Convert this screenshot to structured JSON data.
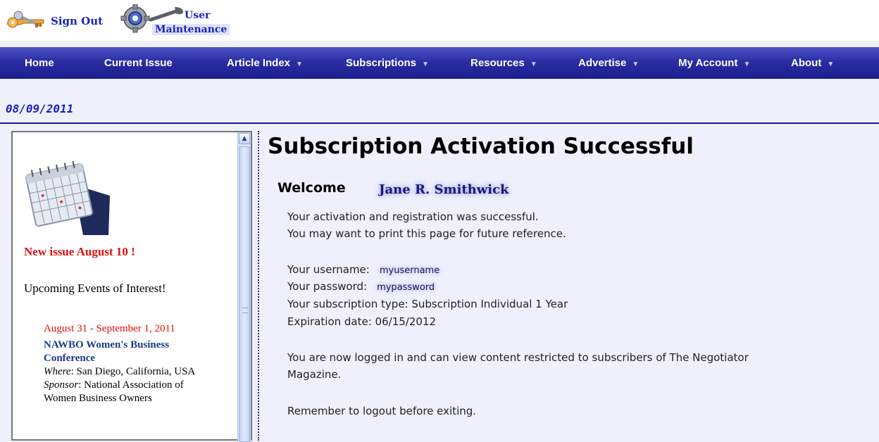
{
  "header": {
    "signout_label": "Sign Out",
    "user_maint_line1": "User",
    "user_maint_line2": "Maintenance"
  },
  "nav": {
    "items": [
      {
        "label": "Home",
        "has_dropdown": false
      },
      {
        "label": "Current Issue",
        "has_dropdown": false
      },
      {
        "label": "Article Index",
        "has_dropdown": true
      },
      {
        "label": "Subscriptions",
        "has_dropdown": true
      },
      {
        "label": "Resources",
        "has_dropdown": true
      },
      {
        "label": "Advertise",
        "has_dropdown": true
      },
      {
        "label": "My Account",
        "has_dropdown": true
      },
      {
        "label": "About",
        "has_dropdown": true
      }
    ],
    "dropdown_glyph": "▼"
  },
  "date": "08/09/2011",
  "sidebar": {
    "new_issue": "New issue August 10 !",
    "upcoming": "Upcoming Events of Interest!",
    "event": {
      "date": "August 31 - September 1,  2011",
      "title": "NAWBO Women's Business Conference",
      "where_key": "Where",
      "where_value": ": San Diego, California, USA",
      "sponsor_key": "Sponsor",
      "sponsor_value": ": National Association of Women Business Owners"
    }
  },
  "main": {
    "title": "Subscription Activation Successful",
    "welcome_label": "Welcome",
    "welcome_name": "Jane R. Smithwick",
    "line1": "Your activation and registration was successful.",
    "line2": "You may want to print this page for future reference.",
    "username_label": "Your username:",
    "username_value": "myusername",
    "password_label": "Your password:",
    "password_value": "mypassword",
    "subscription_line": "Your subscription type: Subscription Individual 1 Year",
    "expiration_line": "Expiration date: 06/15/2012",
    "logged_in_line1": "You are now logged in and can view content restricted to subscribers of The Negotiator",
    "logged_in_line2": "Magazine.",
    "remember_line": "Remember to logout before exiting."
  },
  "colors": {
    "nav_bg": "#2a2ea3",
    "link_blue": "#1a22b8",
    "alert_red": "#e01010",
    "page_bg": "#eef0fb"
  }
}
